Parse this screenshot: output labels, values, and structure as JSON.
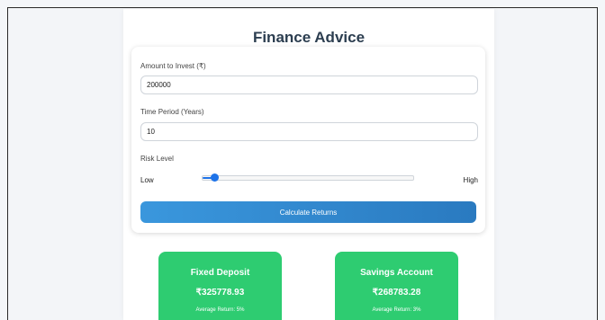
{
  "header": {
    "title": "Finance Advice"
  },
  "form": {
    "amount_label": "Amount to Invest (₹)",
    "amount_value": "200000",
    "period_label": "Time Period (Years)",
    "period_value": "10",
    "risk_label": "Risk Level",
    "risk_low": "Low",
    "risk_high": "High",
    "risk_level_fraction": 0.03,
    "button_label": "Calculate Returns"
  },
  "results": [
    {
      "title": "Fixed Deposit",
      "value": "₹325778.93",
      "note": "Average Return: 5%"
    },
    {
      "title": "Savings Account",
      "value": "₹268783.28",
      "note": "Average Return: 3%"
    }
  ],
  "colors": {
    "accent": "#1e73e8",
    "button": "#2f86cf",
    "result_card": "#2ecc71",
    "title": "#2c3e50"
  }
}
